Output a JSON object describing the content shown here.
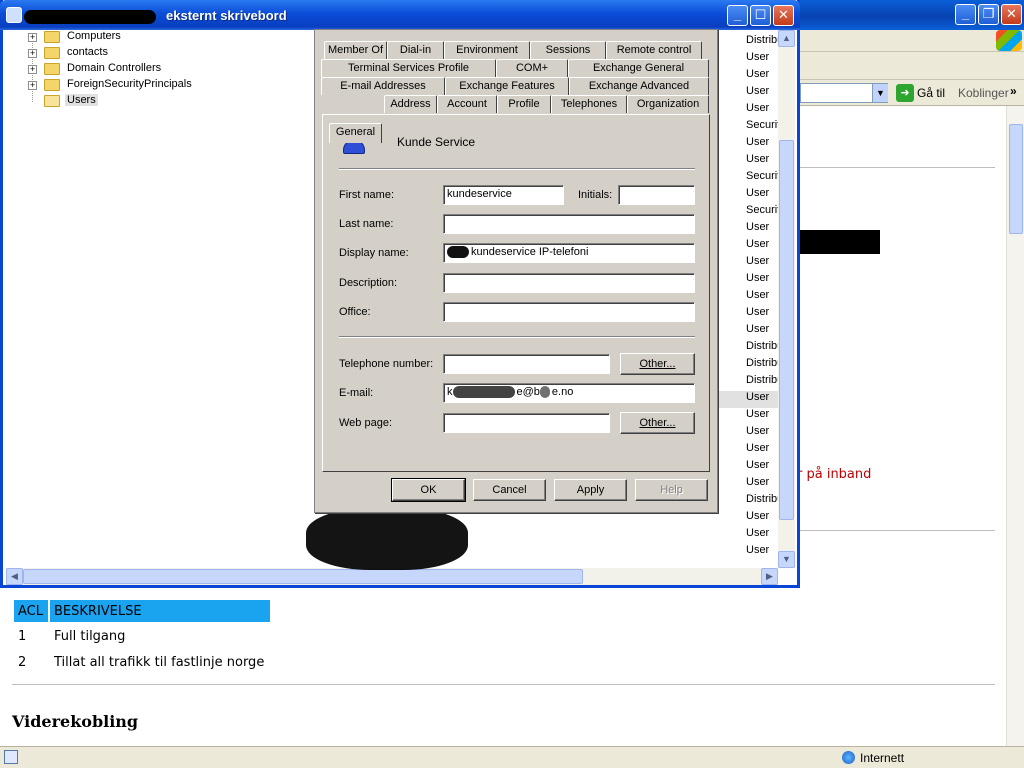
{
  "remote_window": {
    "title": "eksternt skrivebord",
    "tree": [
      {
        "label": "Computers",
        "expandable": true
      },
      {
        "label": "contacts",
        "expandable": true
      },
      {
        "label": "Domain Controllers",
        "expandable": true
      },
      {
        "label": "ForeignSecurityPrincipals",
        "expandable": true
      },
      {
        "label": "Users",
        "expandable": false,
        "selected": true
      }
    ],
    "type_column": [
      "Distribu",
      "User",
      "User",
      "User",
      "User",
      "Securit",
      "User",
      "User",
      "Securit",
      "User",
      "Securit",
      "User",
      "User",
      "User",
      "User",
      "User",
      "User",
      "User",
      "Distribu",
      "Distribu",
      "Distribu",
      "User",
      "User",
      "User",
      "User",
      "User",
      "User",
      "Distribu",
      "User",
      "User",
      "User"
    ],
    "selected_type_index": 21
  },
  "dialog": {
    "tabs_row1": [
      "Member Of",
      "Dial-in",
      "Environment",
      "Sessions",
      "Remote control"
    ],
    "tabs_row2": [
      "Terminal Services Profile",
      "COM+",
      "Exchange General"
    ],
    "tabs_row3": [
      "E-mail Addresses",
      "Exchange Features",
      "Exchange Advanced"
    ],
    "tabs_row4": [
      "General",
      "Address",
      "Account",
      "Profile",
      "Telephones",
      "Organization"
    ],
    "active_tab": "General",
    "user_display": "Kunde Service",
    "fields": {
      "first_name": {
        "label": "First name:",
        "value": "kundeservice"
      },
      "initials": {
        "label": "Initials:",
        "value": ""
      },
      "last_name": {
        "label": "Last name:",
        "value": ""
      },
      "display_name": {
        "label": "Display name:",
        "value": "kundeservice IP-telefoni"
      },
      "description": {
        "label": "Description:",
        "value": ""
      },
      "office": {
        "label": "Office:",
        "value": ""
      },
      "telephone": {
        "label": "Telephone number:",
        "value": ""
      },
      "email": {
        "label": "E-mail:",
        "value_prefix": "k",
        "value_mid": "e@b",
        "value_suffix": "e.no"
      },
      "web_page": {
        "label": "Web page:",
        "value": ""
      }
    },
    "other_button": "Other...",
    "buttons": {
      "ok": "OK",
      "cancel": "Cancel",
      "apply": "Apply",
      "help": "Help"
    }
  },
  "browser": {
    "go_label": "Gå til",
    "links_label": "Koblinger",
    "zone_label": "Internett",
    "red_text": "r på inband",
    "table": {
      "headers": [
        "ACL",
        "BESKRIVELSE"
      ],
      "rows": [
        [
          "1",
          "Full tilgang"
        ],
        [
          "2",
          "Tillat all trafikk til fastlinje norge"
        ]
      ]
    },
    "heading": "Viderekobling"
  },
  "colors": {
    "xp_blue": "#0a46d6",
    "dialog_face": "#d4d0c8",
    "table_header": "#1aa3ef",
    "red_text": "#c00000"
  }
}
